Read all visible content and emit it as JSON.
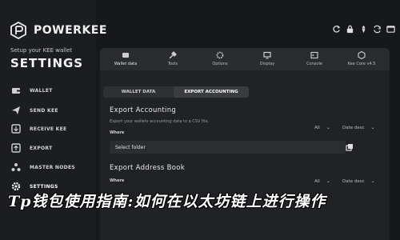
{
  "app": {
    "brand": "POWERKEE",
    "setup_text": "Setup your KEE wallet",
    "page_title": "SETTINGS"
  },
  "sidebar": {
    "items": [
      {
        "label": "WALLET",
        "icon": "wallet-icon"
      },
      {
        "label": "SEND KEE",
        "icon": "send-icon"
      },
      {
        "label": "RECEIVE KEE",
        "icon": "receive-icon"
      },
      {
        "label": "EXPORT",
        "icon": "export-icon"
      },
      {
        "label": "MASTER NODES",
        "icon": "master-nodes-icon"
      },
      {
        "label": "SETTINGS",
        "icon": "settings-icon"
      }
    ]
  },
  "header_icons": [
    "refresh-icon",
    "lock-icon",
    "extension-icon",
    "sync-icon",
    "window-icon"
  ],
  "topbar": {
    "tabs": [
      {
        "label": "Wallet data",
        "icon": "wallet-data-icon",
        "active": true
      },
      {
        "label": "Tools",
        "icon": "tools-icon"
      },
      {
        "label": "Options",
        "icon": "options-icon"
      },
      {
        "label": "Display",
        "icon": "display-icon"
      },
      {
        "label": "Console",
        "icon": "console-icon"
      },
      {
        "label": "Kee Core v4.5",
        "icon": "kee-core-icon"
      }
    ]
  },
  "subtabs": [
    {
      "label": "WALLET DATA"
    },
    {
      "label": "EXPORT ACCOUNTING",
      "active": true
    }
  ],
  "export_accounting": {
    "title": "Export Accounting",
    "description": "Export your wallets accounting data to a CSV file.",
    "where_label": "Where",
    "filter_all": "All",
    "sort": "Date desc",
    "folder_value": "Select folder"
  },
  "export_address_book": {
    "title": "Export Address Book",
    "where_label": "Where",
    "filter_all": "All",
    "sort": "Date desc"
  },
  "banner_text": "Tp钱包使用指南:如何在以太坊链上进行操作"
}
